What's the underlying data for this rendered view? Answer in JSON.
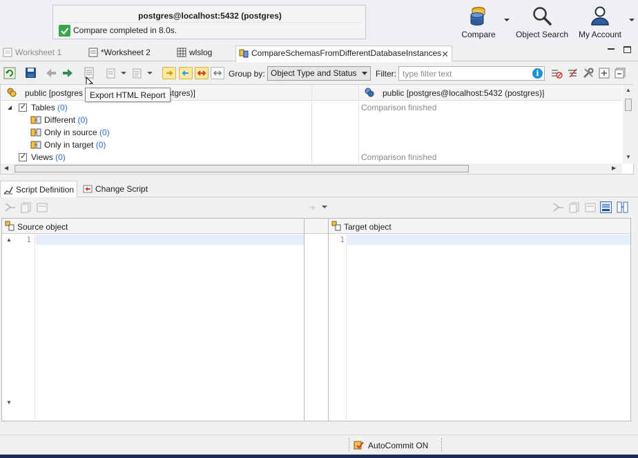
{
  "notification": {
    "title": "postgres@localhost:5432 (postgres)",
    "message": "Compare completed in 8.0s."
  },
  "top_buttons": {
    "compare": "Compare",
    "object_search": "Object Search",
    "my_account": "My Account"
  },
  "tabs": [
    {
      "label": "Worksheet 1",
      "icon": "sql-worksheet-icon",
      "state": "inactive"
    },
    {
      "label": "*Worksheet 2",
      "icon": "sql-worksheet-icon",
      "state": "normal"
    },
    {
      "label": "wlslog",
      "icon": "table-icon",
      "state": "normal"
    },
    {
      "label": "CompareSchemasFromDifferentDatabaseInstances",
      "icon": "compare-schemas-icon",
      "state": "active"
    }
  ],
  "toolbar": {
    "group_by_label": "Group by:",
    "group_by_value": "Object Type and Status",
    "filter_label": "Filter:",
    "filter_placeholder": "type filter text"
  },
  "tooltip": "Export HTML Report",
  "tree": {
    "left_header": "public [postgres@localhost:5432 (postgres)]",
    "left_header_visible": "public [postgres",
    "left_header_tail": "stgres)]",
    "right_header": "public [postgres@localhost:5432 (postgres)]",
    "rows": [
      {
        "label": "Tables",
        "count": "(0)",
        "status": "Comparison finished"
      },
      {
        "label": "Different",
        "count": "(0)",
        "status": ""
      },
      {
        "label": "Only in source",
        "count": "(0)",
        "status": ""
      },
      {
        "label": "Only in target",
        "count": "(0)",
        "status": ""
      },
      {
        "label": "Views",
        "count": "(0)",
        "status": "Comparison finished"
      }
    ]
  },
  "bottom_tabs": [
    {
      "label": "Script Definition",
      "state": "active"
    },
    {
      "label": "Change Script",
      "state": "normal"
    }
  ],
  "editors": {
    "source_title": "Source object",
    "target_title": "Target object",
    "line_number": "1"
  },
  "statusbar": {
    "autocommit": "AutoCommit ON"
  }
}
